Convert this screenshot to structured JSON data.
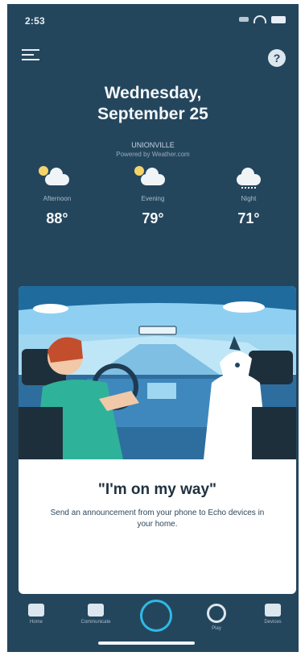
{
  "status_bar": {
    "time": "2:53"
  },
  "header": {
    "date_line1": "Wednesday,",
    "date_line2": "September 25",
    "location": "UNIONVILLE",
    "location_sub": "Powered by Weather.com"
  },
  "forecast": [
    {
      "label": "Afternoon",
      "temp": "88°",
      "icon": "partly-cloudy-icon"
    },
    {
      "label": "Evening",
      "temp": "79°",
      "icon": "cloudy-icon"
    },
    {
      "label": "Night",
      "temp": "71°",
      "icon": "rain-cloud-icon"
    }
  ],
  "card": {
    "title": "\"I'm on my way\"",
    "description": "Send an announcement from your phone to Echo devices in your home."
  },
  "nav": [
    {
      "label": "Home",
      "icon": "home-icon"
    },
    {
      "label": "Communicate",
      "icon": "chat-icon"
    },
    {
      "label": "Alexa",
      "icon": "alexa-ring-icon"
    },
    {
      "label": "Play",
      "icon": "play-icon"
    },
    {
      "label": "Devices",
      "icon": "devices-icon"
    }
  ],
  "colors": {
    "background": "#24465d",
    "accent": "#2fb9e6",
    "card": "#ffffff"
  }
}
